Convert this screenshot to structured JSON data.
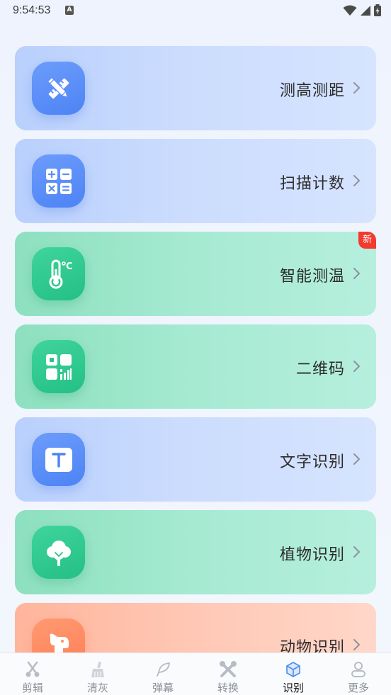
{
  "status_bar": {
    "time": "9:54:53",
    "notification_glyph": "A",
    "icons": [
      "wifi-icon",
      "signal-icon",
      "battery-charging-icon"
    ]
  },
  "tools": [
    {
      "label": "测高测距",
      "icon": "pencil-ruler-icon",
      "theme": "blue"
    },
    {
      "label": "扫描计数",
      "icon": "calculator-icon",
      "theme": "blue"
    },
    {
      "label": "智能测温",
      "icon": "thermometer-icon",
      "theme": "green",
      "badge": "新"
    },
    {
      "label": "二维码",
      "icon": "qr-code-icon",
      "theme": "green"
    },
    {
      "label": "文字识别",
      "icon": "text-recognition-icon",
      "theme": "blue"
    },
    {
      "label": "植物识别",
      "icon": "tree-icon",
      "theme": "green"
    },
    {
      "label": "动物识别",
      "icon": "dog-icon",
      "theme": "orange"
    }
  ],
  "bottom_nav": [
    {
      "label": "剪辑",
      "icon": "scissors-icon"
    },
    {
      "label": "清灰",
      "icon": "brush-icon"
    },
    {
      "label": "弹幕",
      "icon": "feather-icon"
    },
    {
      "label": "转换",
      "icon": "tools-icon"
    },
    {
      "label": "识别",
      "icon": "cube-icon",
      "active": true
    },
    {
      "label": "更多",
      "icon": "person-icon"
    }
  ],
  "colors": {
    "blue_tile": "#4d83f5",
    "green_tile": "#24c085",
    "orange_tile": "#ff7e55",
    "badge": "#f23a2e",
    "active_nav": "#4a8cf0"
  }
}
